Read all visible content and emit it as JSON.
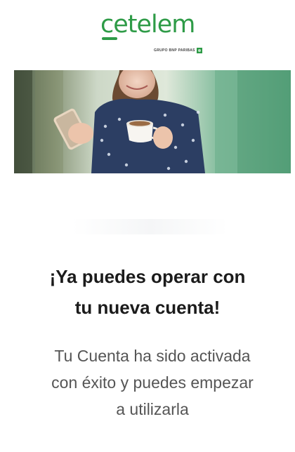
{
  "brand": {
    "name": "cetelem",
    "tagline": "GRUPO BNP PARIBAS",
    "color": "#2e9b47"
  },
  "hero": {
    "subject": "woman-with-phone-and-coffee-image"
  },
  "confirmation": {
    "title_line1": "¡Ya puedes operar con",
    "title_line2": "tu nueva cuenta!",
    "message_line1": "Tu Cuenta ha sido activada",
    "message_line2": "con éxito y puedes empezar",
    "message_line3": "a utilizarla"
  },
  "colors": {
    "title": "#1b1b1b",
    "message": "#555555"
  }
}
